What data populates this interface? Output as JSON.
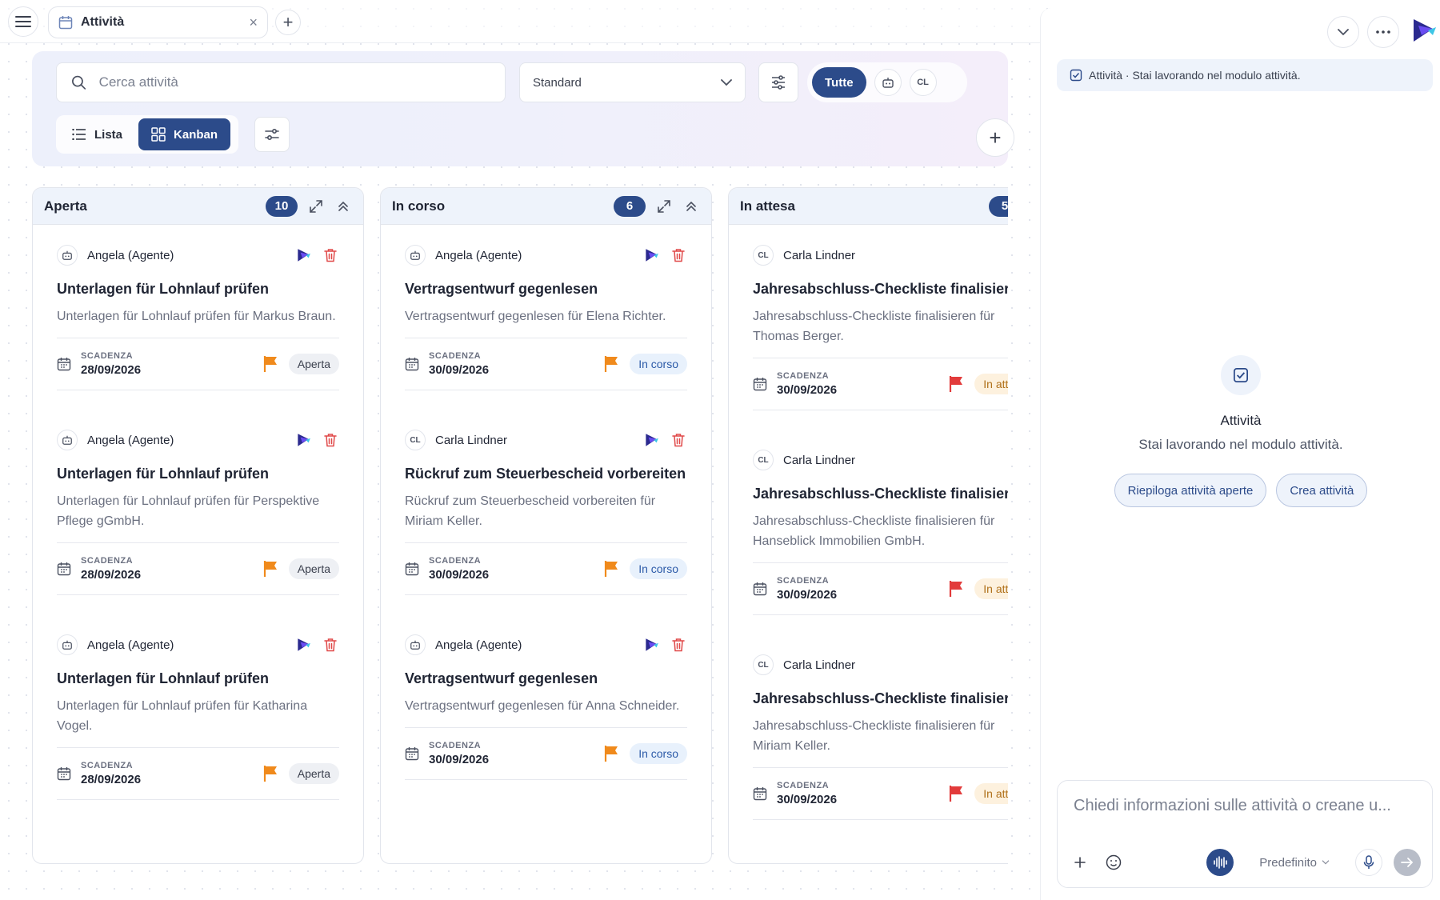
{
  "colors": {
    "accent": "#2c4b8a",
    "danger": "#e04848",
    "flag_orange": "#f08a1c",
    "flag_red": "#e23b3b",
    "header_bg": "#eef3fb"
  },
  "topbar": {
    "menu_icon": "hamburger-icon",
    "tab": {
      "label": "Attività",
      "icon": "calendar-icon",
      "close": "×"
    },
    "add_tab": "+"
  },
  "toolbar": {
    "search": {
      "placeholder": "Cerca attività",
      "value": ""
    },
    "view_select": {
      "value": "Standard"
    },
    "filters": {
      "active": "Tutte",
      "agent_icon": "robot-icon",
      "user_initials": "CL"
    },
    "view_toggle": {
      "list_label": "Lista",
      "kanban_label": "Kanban",
      "active": "Kanban"
    },
    "add_label": "+"
  },
  "board": {
    "due_label": "SCADENZA",
    "columns": [
      {
        "title": "Aperta",
        "count": "10",
        "collapse": true,
        "cards": [
          {
            "assignee": "Angela (Agente)",
            "avatar": "robot",
            "title": "Unterlagen für Lohnlauf prüfen",
            "description": "Unterlagen für Lohnlauf prüfen für Markus Braun.",
            "due": "28/09/2026",
            "flag": "orange",
            "status": "Aperta",
            "delete": true
          },
          {
            "assignee": "Angela (Agente)",
            "avatar": "robot",
            "title": "Unterlagen für Lohnlauf prüfen",
            "description": "Unterlagen für Lohnlauf prüfen für Perspektive Pflege gGmbH.",
            "due": "28/09/2026",
            "flag": "orange",
            "status": "Aperta",
            "delete": true
          },
          {
            "assignee": "Angela (Agente)",
            "avatar": "robot",
            "title": "Unterlagen für Lohnlauf prüfen",
            "description": "Unterlagen für Lohnlauf prüfen für Katharina Vogel.",
            "due": "28/09/2026",
            "flag": "orange",
            "status": "Aperta",
            "delete": true
          }
        ]
      },
      {
        "title": "In corso",
        "count": "6",
        "collapse": true,
        "cards": [
          {
            "assignee": "Angela (Agente)",
            "avatar": "robot",
            "title": "Vertragsentwurf gegenlesen",
            "description": "Vertragsentwurf gegenlesen für Elena Richter.",
            "due": "30/09/2026",
            "flag": "orange",
            "status": "In corso",
            "delete": true
          },
          {
            "assignee": "Carla Lindner",
            "avatar": "CL",
            "title": "Rückruf zum Steuerbescheid vorbereiten",
            "description": "Rückruf zum Steuerbescheid vorbereiten für Miriam Keller.",
            "due": "30/09/2026",
            "flag": "orange",
            "status": "In corso",
            "delete": true
          },
          {
            "assignee": "Angela (Agente)",
            "avatar": "robot",
            "title": "Vertragsentwurf gegenlesen",
            "description": "Vertragsentwurf gegenlesen für Anna Schneider.",
            "due": "30/09/2026",
            "flag": "orange",
            "status": "In corso",
            "delete": true
          }
        ]
      },
      {
        "title": "In attesa",
        "count": "5",
        "collapse": false,
        "cards": [
          {
            "assignee": "Carla Lindner",
            "avatar": "CL",
            "title": "Jahresabschluss-Checkliste finalisieren",
            "description": "Jahresabschluss-Checkliste finalisieren für Thomas Berger.",
            "due": "30/09/2026",
            "flag": "red",
            "status": "In attesa",
            "delete": false
          },
          {
            "assignee": "Carla Lindner",
            "avatar": "CL",
            "title": "Jahresabschluss-Checkliste finalisieren",
            "description": "Jahresabschluss-Checkliste finalisieren für Hanseblick Immobilien GmbH.",
            "due": "30/09/2026",
            "flag": "red",
            "status": "In attesa",
            "delete": false
          },
          {
            "assignee": "Carla Lindner",
            "avatar": "CL",
            "title": "Jahresabschluss-Checkliste finalisieren",
            "description": "Jahresabschluss-Checkliste finalisieren für Miriam Keller.",
            "due": "30/09/2026",
            "flag": "red",
            "status": "In attesa",
            "delete": false
          }
        ]
      }
    ]
  },
  "assistant": {
    "context": "Attività · Stai lavorando nel modulo attività.",
    "empty_title": "Attività",
    "empty_subtitle": "Stai lavorando nel modulo attività.",
    "suggestions": [
      "Riepiloga attività aperte",
      "Crea attività"
    ],
    "composer_placeholder": "Chiedi informazioni sulle attività o creane u...",
    "model": "Predefinito"
  }
}
